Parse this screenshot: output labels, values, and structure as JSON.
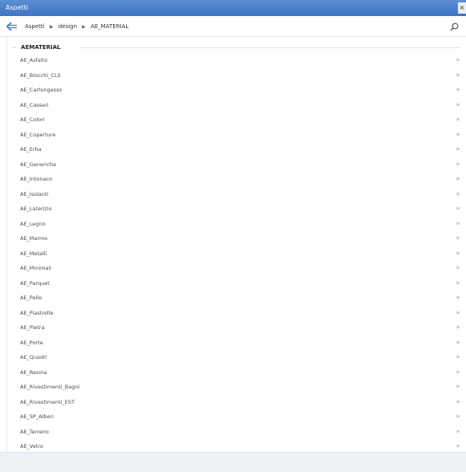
{
  "window": {
    "title": "Aspetti",
    "close_label": "×"
  },
  "breadcrumb": [
    "Aspetti",
    "design",
    "AE_MATERIAL"
  ],
  "group": {
    "title": "AEMATERIAL"
  },
  "items": [
    "AE_Asfalto",
    "AE_Blocchi_CLS",
    "AE_Cartongesso",
    "AE_Casseri",
    "AE_Colori",
    "AE_Coperture",
    "AE_Erba",
    "AE_Generiche",
    "AE_Intonaco",
    "AE_Isolanti",
    "AE_Laterizio",
    "AE_Legno",
    "AE_Marmo",
    "AE_Metalli",
    "AE_Minimali",
    "AE_Parquet",
    "AE_Pelle",
    "AE_Piastrelle",
    "AE_Pietra",
    "AE_Porte",
    "AE_Quadri",
    "AE_Resina",
    "AE_Rivestimenti_Bagni",
    "AE_Rivestimenti_EST",
    "AE_SP_Alberi",
    "AE_Terreno",
    "AE_Vetro"
  ],
  "icons": {
    "back": "back-arrow-icon",
    "search": "search-icon",
    "chevron": "chevron-right-icon",
    "separator": "triangle-right-icon"
  },
  "colors": {
    "titlebar": "#4a7fcb",
    "accent": "#3f74c2"
  }
}
